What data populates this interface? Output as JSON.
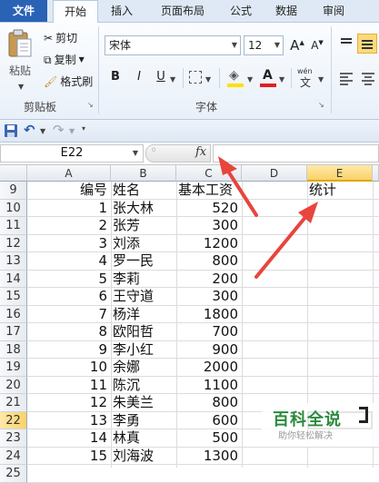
{
  "ribbon_tabs": [
    "文件",
    "开始",
    "插入",
    "页面布局",
    "公式",
    "数据",
    "审阅"
  ],
  "clipboard": {
    "paste_label": "粘贴",
    "cut_label": "剪切",
    "copy_label": "复制",
    "format_painter_label": "格式刷",
    "group_label": "剪贴板"
  },
  "font": {
    "name": "宋体",
    "size": "12",
    "bold_label": "B",
    "italic_label": "I",
    "underline_label": "U",
    "group_label": "字体",
    "grow_label": "A",
    "shrink_label": "A",
    "font_color_label": "A",
    "phonetic_label": "wén"
  },
  "name_box": "E22",
  "fx_label": "fx",
  "formula_value": "",
  "columns": [
    "A",
    "B",
    "C",
    "D",
    "E"
  ],
  "selected_column": "E",
  "selected_row": "22",
  "rows": [
    {
      "n": "9",
      "a": "编号",
      "b": "姓名",
      "c": "基本工资",
      "e": "统计"
    },
    {
      "n": "10",
      "a": "1",
      "b": "张大林",
      "c": "520",
      "e": ""
    },
    {
      "n": "11",
      "a": "2",
      "b": "张芳",
      "c": "300",
      "e": ""
    },
    {
      "n": "12",
      "a": "3",
      "b": "刘添",
      "c": "1200",
      "e": ""
    },
    {
      "n": "13",
      "a": "4",
      "b": "罗一民",
      "c": "800",
      "e": ""
    },
    {
      "n": "14",
      "a": "5",
      "b": "李莉",
      "c": "200",
      "e": ""
    },
    {
      "n": "15",
      "a": "6",
      "b": "王守道",
      "c": "300",
      "e": ""
    },
    {
      "n": "16",
      "a": "7",
      "b": "杨洋",
      "c": "1800",
      "e": ""
    },
    {
      "n": "17",
      "a": "8",
      "b": "欧阳哲",
      "c": "700",
      "e": ""
    },
    {
      "n": "18",
      "a": "9",
      "b": "李小红",
      "c": "900",
      "e": ""
    },
    {
      "n": "19",
      "a": "10",
      "b": "余娜",
      "c": "2000",
      "e": ""
    },
    {
      "n": "20",
      "a": "11",
      "b": "陈沉",
      "c": "1100",
      "e": ""
    },
    {
      "n": "21",
      "a": "12",
      "b": "朱美兰",
      "c": "800",
      "e": ""
    },
    {
      "n": "22",
      "a": "13",
      "b": "李勇",
      "c": "600",
      "e": ""
    },
    {
      "n": "23",
      "a": "14",
      "b": "林真",
      "c": "500",
      "e": ""
    },
    {
      "n": "24",
      "a": "15",
      "b": "刘海波",
      "c": "1300",
      "e": ""
    },
    {
      "n": "25",
      "a": "",
      "b": "",
      "c": "",
      "e": ""
    }
  ],
  "watermark": {
    "title": "百科全说",
    "subtitle": "助你轻松解决"
  },
  "colors": {
    "file_tab": "#2a62b6",
    "selection": "#f9d26a",
    "arrow": "#e8453c"
  }
}
